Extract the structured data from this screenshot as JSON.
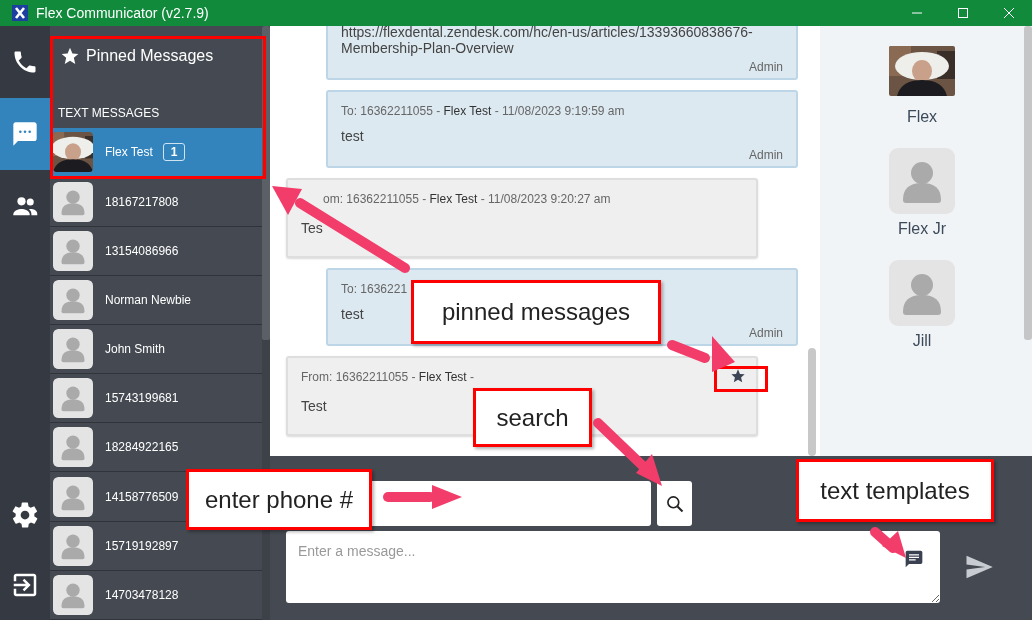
{
  "window": {
    "title": "Flex Communicator (v2.7.9)"
  },
  "rail": {
    "items": [
      {
        "kind": "phone",
        "selected": false
      },
      {
        "kind": "messages",
        "selected": true
      },
      {
        "kind": "contacts",
        "selected": false
      }
    ],
    "bottom": [
      {
        "kind": "settings"
      },
      {
        "kind": "logout"
      }
    ]
  },
  "conversations": {
    "pinned_header": "Pinned Messages",
    "section": "TEXT MESSAGES",
    "items": [
      {
        "name": "Flex Test",
        "badge": "1",
        "selected": true
      },
      {
        "name": "18167217808",
        "kind": "default",
        "selected": false
      },
      {
        "name": "13154086966",
        "kind": "default",
        "selected": false
      },
      {
        "name": "Norman Newbie",
        "kind": "default",
        "selected": false
      },
      {
        "name": "John Smith",
        "kind": "default",
        "selected": false
      },
      {
        "name": "15743199681",
        "kind": "default",
        "selected": false
      },
      {
        "name": "18284922165",
        "kind": "default",
        "selected": false
      },
      {
        "name": "14158776509",
        "kind": "default",
        "selected": false
      },
      {
        "name": "15719192897",
        "kind": "default",
        "selected": false
      },
      {
        "name": "14703478128",
        "kind": "default",
        "selected": false
      }
    ]
  },
  "messages": [
    {
      "kind": "sent",
      "body": "https://flexdental.zendesk.com/hc/en-us/articles/13393660838676-Membership-Plan-Overview",
      "sender": "Admin",
      "pinned": false
    },
    {
      "kind": "sent",
      "header": "To: 16362211055 - **Flex Test** - 11/08/2023 9:19:59 am",
      "body": "test",
      "sender": "Admin",
      "pinned": false
    },
    {
      "kind": "received",
      "header": "om: 16362211055 - **Flex Test** - 11/08/2023 9:20:27 am",
      "body": "Tes",
      "pinned": false
    },
    {
      "kind": "sent",
      "header": "To: 1636221",
      "body": "test",
      "sender": "Admin",
      "pinned": false
    },
    {
      "kind": "received",
      "header": "From: 16362211055 - **Flex Test** -",
      "body": "Test",
      "pinned": true
    }
  ],
  "agents": [
    {
      "name": "Flex"
    },
    {
      "name": "Flex Jr",
      "kind": "default"
    },
    {
      "name": "Jill",
      "kind": "default"
    }
  ],
  "composer": {
    "message_placeholder": "Enter a message..."
  },
  "annotations": [
    {
      "text": "pinned messages"
    },
    {
      "text": "search"
    },
    {
      "text": "enter phone #"
    },
    {
      "text": "text templates"
    }
  ]
}
